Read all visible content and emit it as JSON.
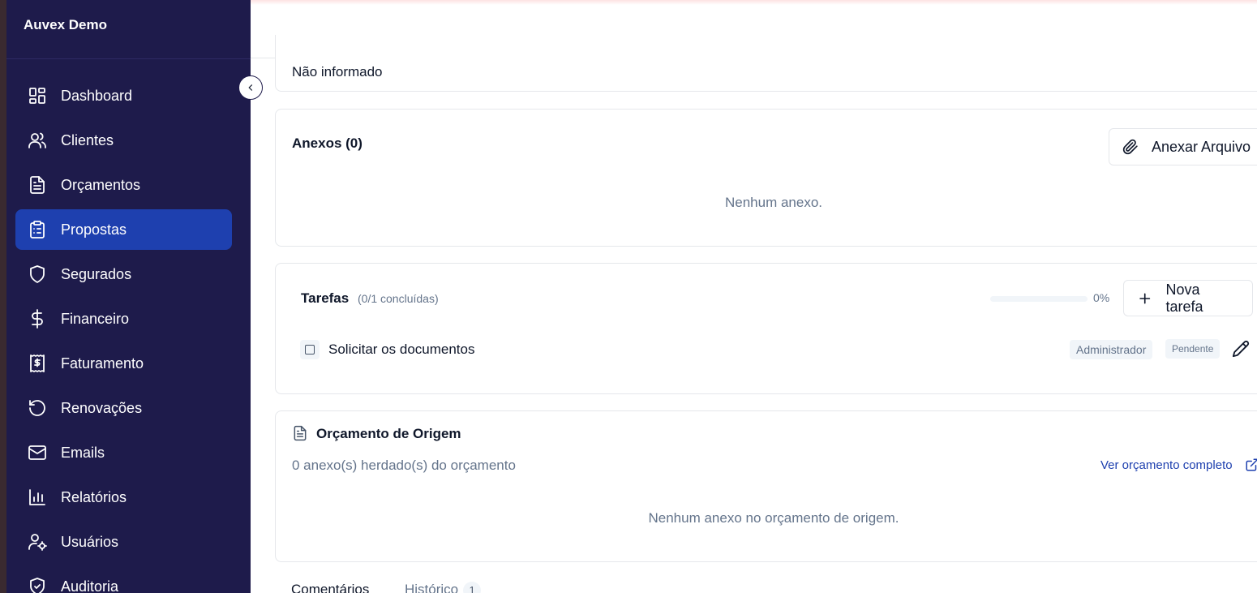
{
  "sidebar": {
    "brand": "Auvex Demo",
    "items": [
      {
        "label": "Dashboard",
        "icon": "dashboard-icon"
      },
      {
        "label": "Clientes",
        "icon": "users-icon"
      },
      {
        "label": "Orçamentos",
        "icon": "file-text-icon"
      },
      {
        "label": "Propostas",
        "icon": "clipboard-list-icon",
        "active": true
      },
      {
        "label": "Segurados",
        "icon": "shield-icon"
      },
      {
        "label": "Financeiro",
        "icon": "dollar-icon"
      },
      {
        "label": "Faturamento",
        "icon": "receipt-icon"
      },
      {
        "label": "Renovações",
        "icon": "rotate-ccw-icon"
      },
      {
        "label": "Emails",
        "icon": "mail-icon"
      },
      {
        "label": "Relatórios",
        "icon": "bar-chart-icon"
      },
      {
        "label": "Usuários",
        "icon": "user-cog-icon"
      },
      {
        "label": "Auditoria",
        "icon": "shield-check-icon"
      }
    ]
  },
  "info_card": {
    "value": "Não informado"
  },
  "anexos": {
    "title": "Anexos (0)",
    "attach_button": "Anexar Arquivo",
    "empty": "Nenhum anexo."
  },
  "tarefas": {
    "title": "Tarefas",
    "count": "(0/1 concluídas)",
    "progress_percent": 0,
    "progress_label": "0%",
    "new_button": "Nova tarefa",
    "items": [
      {
        "text": "Solicitar os documentos",
        "assignee": "Administrador",
        "status": "Pendente",
        "done": false
      }
    ]
  },
  "origem": {
    "title": "Orçamento de Origem",
    "subtitle": "0 anexo(s) herdado(s) do orçamento",
    "link": "Ver orçamento completo",
    "empty": "Nenhum anexo no orçamento de origem."
  },
  "tabs": {
    "comentarios": "Comentários",
    "historico": "Histórico",
    "historico_count": "1"
  },
  "colors": {
    "sidebar_bg": "#1e1b4b",
    "active_item": "#1e40af",
    "link": "#1e40af",
    "muted_text": "#64748b"
  }
}
